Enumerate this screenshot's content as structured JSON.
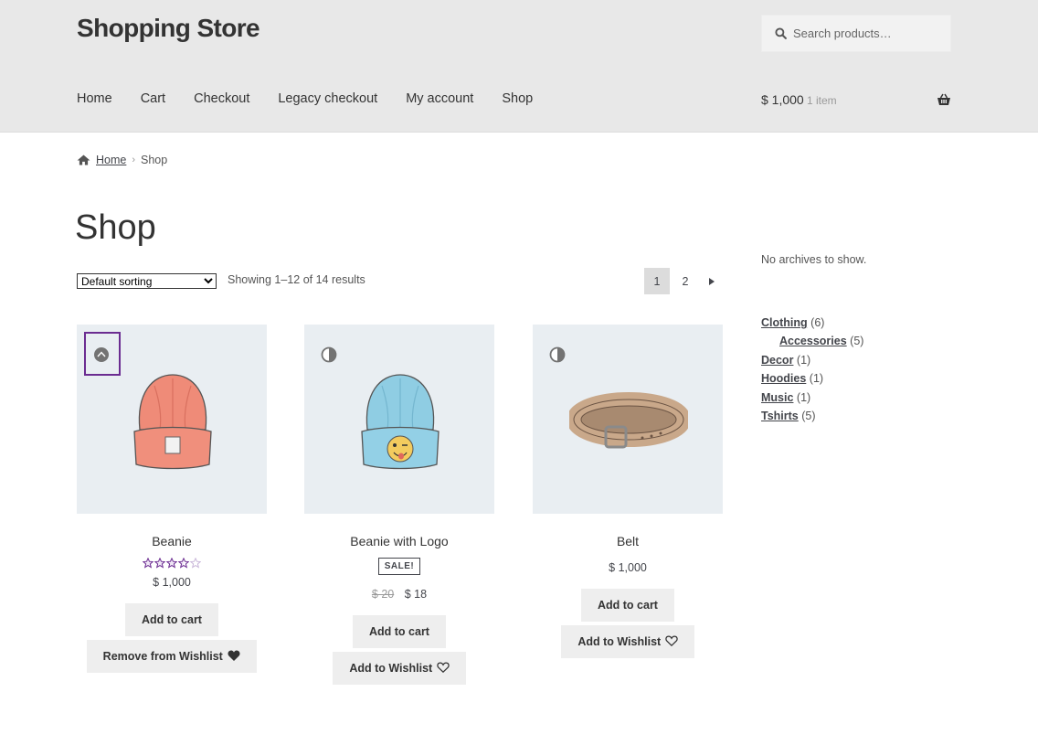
{
  "header": {
    "site_title": "Shopping Store",
    "search_placeholder": "Search products…",
    "nav": [
      "Home",
      "Cart",
      "Checkout",
      "Legacy checkout",
      "My account",
      "Shop"
    ],
    "cart_total": "$ 1,000",
    "cart_count": "1 item"
  },
  "breadcrumb": {
    "home": "Home",
    "current": "Shop"
  },
  "page": {
    "title": "Shop",
    "sorting_selected": "Default sorting",
    "result_count": "Showing 1–12 of 14 results",
    "pages": [
      "1",
      "2"
    ],
    "current_page": "1"
  },
  "products": [
    {
      "name": "Beanie",
      "rating": 3.5,
      "rating_max": 5,
      "price": "$ 1,000",
      "add_to_cart": "Add to cart",
      "wishlist": "Remove from Wishlist",
      "wishlist_icon": "heart-filled-icon"
    },
    {
      "name": "Beanie with Logo",
      "sale_badge": "SALE!",
      "old_price": "$ 20",
      "price": "$ 18",
      "add_to_cart": "Add to cart",
      "wishlist": "Add to Wishlist",
      "wishlist_icon": "heart-outline-icon"
    },
    {
      "name": "Belt",
      "price": "$ 1,000",
      "add_to_cart": "Add to cart",
      "wishlist": "Add to Wishlist",
      "wishlist_icon": "heart-outline-icon"
    }
  ],
  "sidebar": {
    "archives_empty": "No archives to show.",
    "categories": [
      {
        "name": "Clothing",
        "count": "(6)"
      },
      {
        "name": "Accessories",
        "count": "(5)",
        "sub": true
      },
      {
        "name": "Decor",
        "count": "(1)"
      },
      {
        "name": "Hoodies",
        "count": "(1)"
      },
      {
        "name": "Music",
        "count": "(1)"
      },
      {
        "name": "Tshirts",
        "count": "(5)"
      }
    ]
  },
  "colors": {
    "header_bg": "#e8e8e8",
    "product_bg": "#e9eef2",
    "button_bg": "#eeeeee",
    "star_color": "#6b2c91",
    "focus_outline": "#6b2c91"
  }
}
